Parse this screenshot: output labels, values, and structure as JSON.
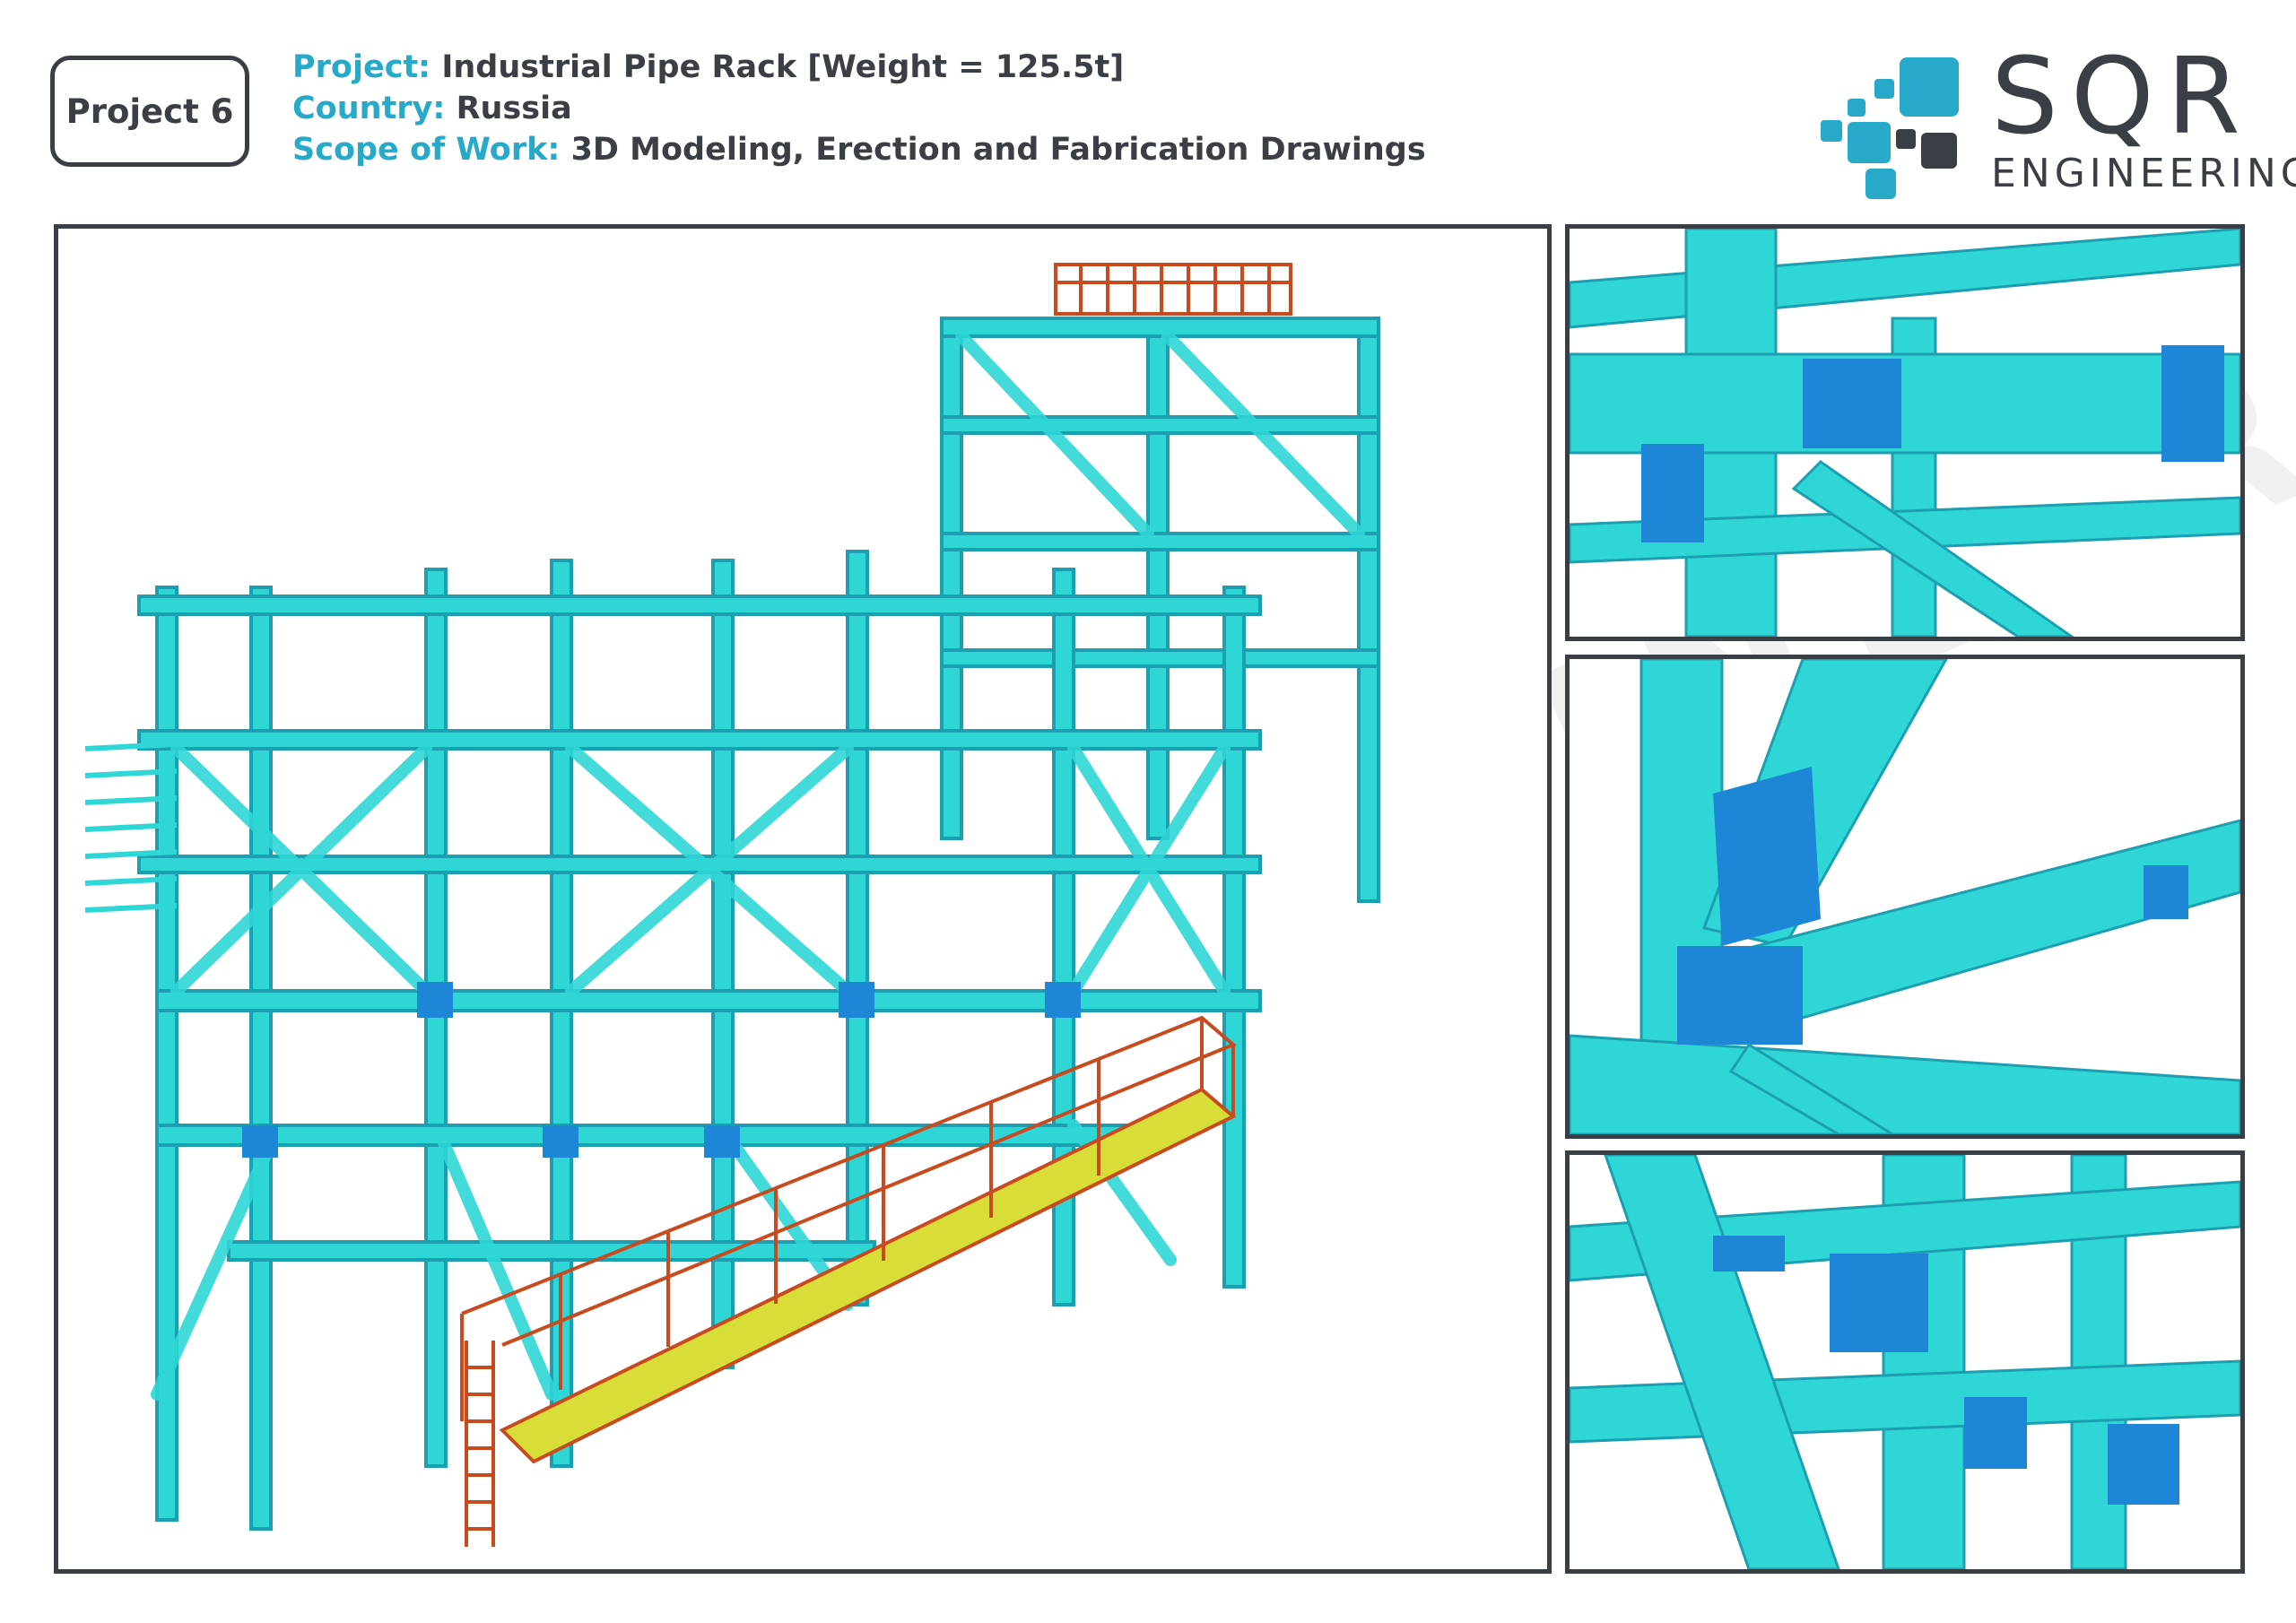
{
  "badge": {
    "label": "Project 6"
  },
  "info": {
    "project_key": "Project:",
    "project_value": "Industrial Pipe Rack [Weight = 125.5t]",
    "country_key": "Country:",
    "country_value": "Russia",
    "scope_key": "Scope of Work:",
    "scope_value": "3D Modeling, Erection and Fabrication Drawings"
  },
  "logo": {
    "name": "SQR",
    "sub": "ENGINEERING"
  },
  "watermark": {
    "text": "ENGINEERING"
  },
  "colors": {
    "accent": "#27a9c9",
    "text": "#3a3e45",
    "steel": "#2fd6d6",
    "steel_dark": "#1c9fb0",
    "plate": "#1e86d6",
    "platform": "#c84a1f",
    "grating": "#d8dd38"
  },
  "icons": [
    "sqr-logo-icon"
  ],
  "images": {
    "main": "3d-model-pipe-rack",
    "detail_1": "connection-detail-top",
    "detail_2": "bracing-gusset-detail",
    "detail_3": "column-base-detail"
  }
}
